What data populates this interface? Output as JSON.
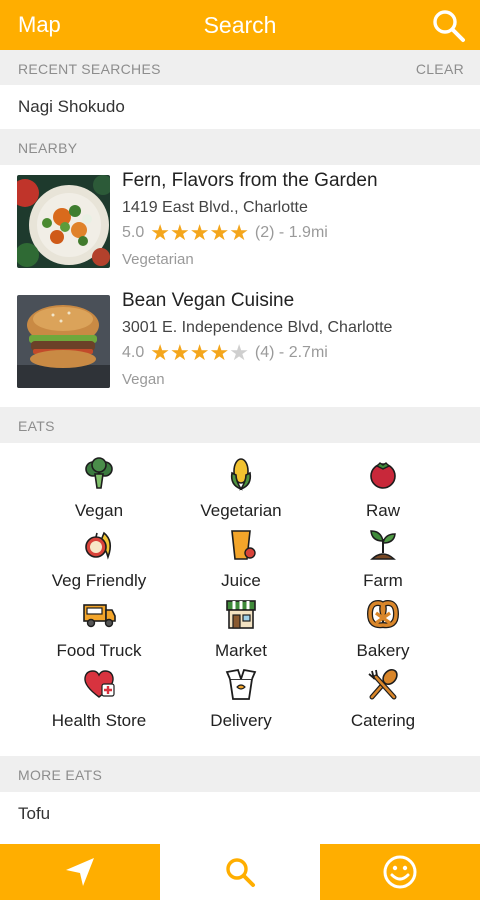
{
  "header": {
    "map_label": "Map",
    "title": "Search",
    "search_icon": "search-icon"
  },
  "recent": {
    "heading": "RECENT SEARCHES",
    "clear_label": "CLEAR",
    "items": [
      "Nagi Shokudo"
    ]
  },
  "nearby": {
    "heading": "NEARBY",
    "places": [
      {
        "name": "Fern, Flavors from the Garden",
        "address": "1419 East Blvd., Charlotte",
        "rating": "5.0",
        "stars": 5,
        "reviews_distance": "(2) - 1.9mi",
        "category": "Vegetarian"
      },
      {
        "name": "Bean Vegan Cuisine",
        "address": "3001 E. Independence Blvd, Charlotte",
        "rating": "4.0",
        "stars": 4,
        "reviews_distance": "(4) - 2.7mi",
        "category": "Vegan"
      }
    ]
  },
  "eats": {
    "heading": "EATS",
    "items": [
      {
        "label": "Vegan",
        "icon": "broccoli-icon"
      },
      {
        "label": "Vegetarian",
        "icon": "corn-icon"
      },
      {
        "label": "Raw",
        "icon": "tomato-icon"
      },
      {
        "label": "Veg Friendly",
        "icon": "apple-banana-icon"
      },
      {
        "label": "Juice",
        "icon": "juice-glass-icon"
      },
      {
        "label": "Farm",
        "icon": "sprout-icon"
      },
      {
        "label": "Food Truck",
        "icon": "food-truck-icon"
      },
      {
        "label": "Market",
        "icon": "market-stall-icon"
      },
      {
        "label": "Bakery",
        "icon": "pretzel-icon"
      },
      {
        "label": "Health Store",
        "icon": "heart-plus-icon"
      },
      {
        "label": "Delivery",
        "icon": "takeout-box-icon"
      },
      {
        "label": "Catering",
        "icon": "spoon-fork-icon"
      }
    ]
  },
  "more_eats": {
    "heading": "MORE EATS",
    "items": [
      "Tofu"
    ]
  },
  "tabs": [
    {
      "icon": "navigation-arrow-icon",
      "active": false
    },
    {
      "icon": "search-icon",
      "active": true
    },
    {
      "icon": "smiley-icon",
      "active": false
    }
  ],
  "colors": {
    "accent": "#ffae00",
    "star": "#f4a61c",
    "section_bg": "#efefef"
  }
}
